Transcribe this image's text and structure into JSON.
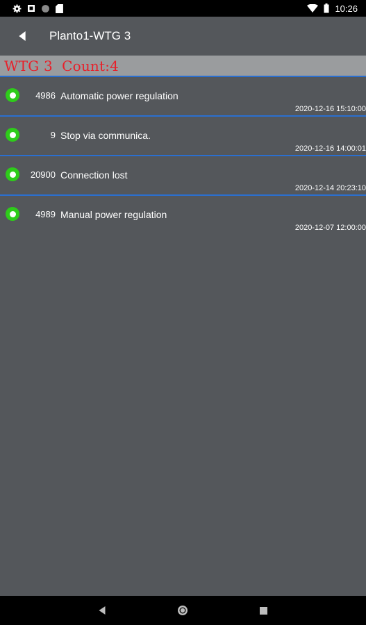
{
  "status_bar": {
    "time": "10:26",
    "left_icons": [
      "settings-icon",
      "stop-icon",
      "circle-icon",
      "sd-card-icon"
    ],
    "right_icons": [
      "wifi-icon",
      "battery-icon"
    ]
  },
  "app_bar": {
    "title": "Planto1-WTG 3",
    "back_icon": "back-arrow-icon"
  },
  "summary": {
    "text": "WTG 3  Count:4",
    "color": "#e8202a"
  },
  "events": [
    {
      "code": "4986",
      "description": "Automatic power regulation",
      "timestamp": "2020-12-16 15:10:00",
      "status_color": "#2ecc1a"
    },
    {
      "code": "9",
      "description": "Stop via communica.",
      "timestamp": "2020-12-16 14:00:01",
      "status_color": "#2ecc1a"
    },
    {
      "code": "20900",
      "description": "Connection lost",
      "timestamp": "2020-12-14 20:23:10",
      "status_color": "#2ecc1a"
    },
    {
      "code": "4989",
      "description": "Manual power regulation",
      "timestamp": "2020-12-07 12:00:00",
      "status_color": "#2ecc1a"
    }
  ],
  "nav_bar": {
    "icons": [
      "nav-back-icon",
      "nav-home-icon",
      "nav-recents-icon"
    ]
  }
}
